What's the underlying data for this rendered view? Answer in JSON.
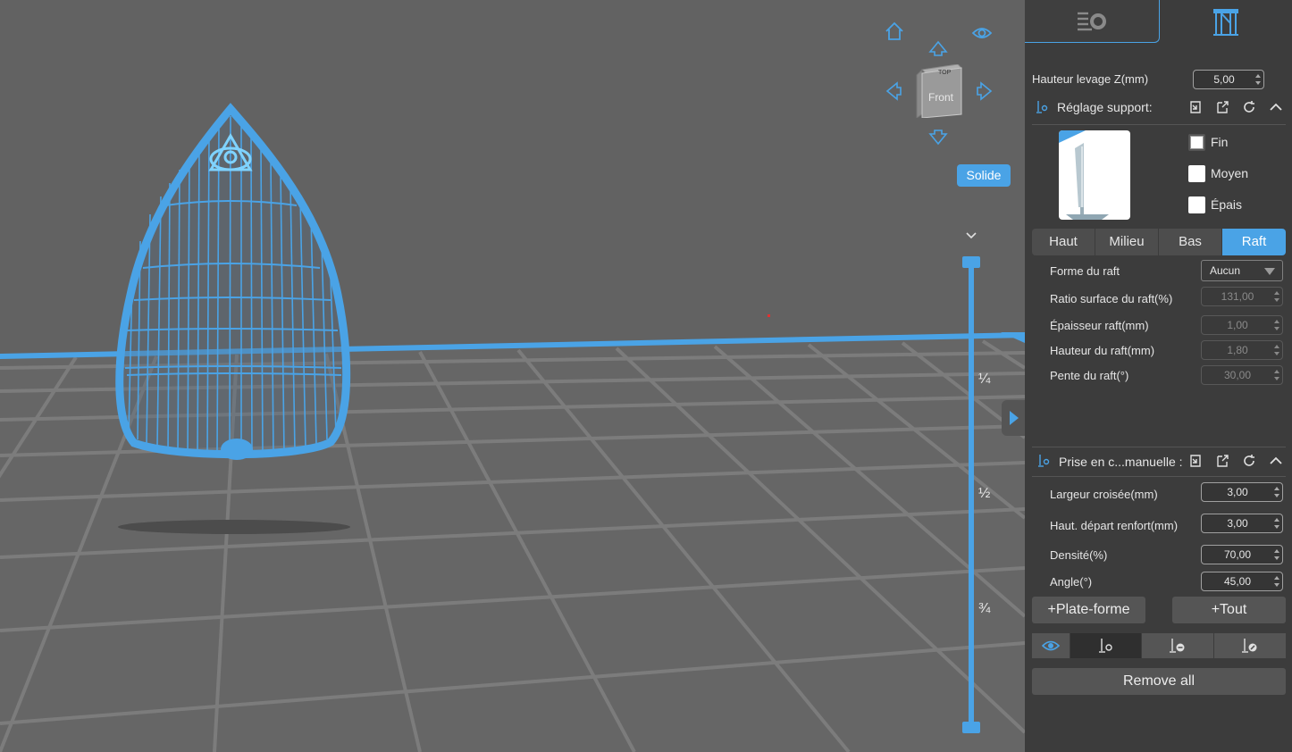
{
  "viewport": {
    "view_cube": {
      "face_label": "Front"
    },
    "solid_button_label": "Solide",
    "layer_slider": {
      "marks": [
        "¼",
        "½",
        "¾"
      ]
    }
  },
  "panel": {
    "lift_height": {
      "label": "Hauteur levage Z(mm)",
      "value": "5,00"
    },
    "support_settings": {
      "title": "Réglage support:",
      "density_options": [
        {
          "label": "Fin",
          "checked": true
        },
        {
          "label": "Moyen",
          "checked": false
        },
        {
          "label": "Épais",
          "checked": false
        }
      ],
      "level_tabs": [
        "Haut",
        "Milieu",
        "Bas",
        "Raft"
      ],
      "selected_level_tab": "Raft",
      "raft_shape": {
        "label": "Forme du raft",
        "value": "Aucun"
      },
      "fields": [
        {
          "label": "Ratio surface du raft(%)",
          "value": "131,00"
        },
        {
          "label": "Épaisseur raft(mm)",
          "value": "1,00"
        },
        {
          "label": "Hauteur du raft(mm)",
          "value": "1,80"
        },
        {
          "label": "Pente du raft(°)",
          "value": "30,00"
        }
      ]
    },
    "manual_support": {
      "title": "Prise en c...manuelle :",
      "fields": [
        {
          "label": "Largeur croisée(mm)",
          "value": "3,00"
        },
        {
          "label": "Haut. départ renfort(mm)",
          "value": "3,00"
        },
        {
          "label": "Densité(%)",
          "value": "70,00"
        },
        {
          "label": "Angle(°)",
          "value": "45,00"
        }
      ],
      "add_platform_label": "+Plate-forme",
      "add_all_label": "+Tout",
      "remove_all_label": "Remove all"
    }
  },
  "colors": {
    "accent": "#4aa3e6",
    "viewport_bg": "#626262",
    "panel_bg": "#3c3c3c"
  }
}
